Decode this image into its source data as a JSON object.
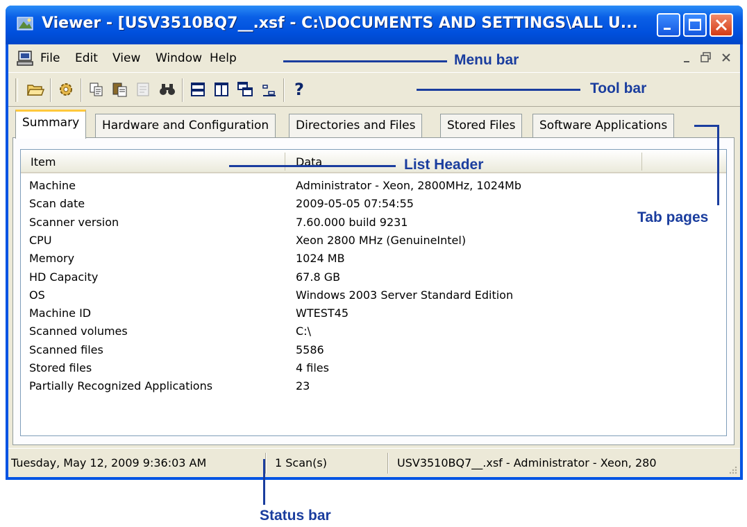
{
  "window": {
    "title": "Viewer - [USV3510BQ7__.xsf - C:\\DOCUMENTS AND SETTINGS\\ALL U...",
    "controls": [
      "minimize-icon",
      "maximize-icon",
      "close-icon"
    ]
  },
  "menu": {
    "items": [
      "File",
      "Edit",
      "View",
      "Window",
      "Help"
    ],
    "mdi_controls": [
      "_",
      "х",
      "×"
    ]
  },
  "toolbar": {
    "icons": [
      "open-icon",
      "settings-icon",
      "copy-icon",
      "paste-icon",
      "properties-icon",
      "find-icon",
      "split-horizontal-icon",
      "split-vertical-icon",
      "cascade-icon",
      "arrange-icon",
      "help-icon"
    ],
    "help_label": "?"
  },
  "tabs": [
    {
      "label": "Summary",
      "active": true
    },
    {
      "label": "Hardware and Configuration",
      "active": false
    },
    {
      "label": "Directories and Files",
      "active": false
    },
    {
      "label": "Stored Files",
      "active": false
    },
    {
      "label": "Software Applications",
      "active": false
    }
  ],
  "list": {
    "headers": [
      "Item",
      "Data"
    ],
    "rows": [
      {
        "item": "Machine",
        "data": "Administrator - Xeon, 2800MHz, 1024Mb"
      },
      {
        "item": "Scan date",
        "data": "2009-05-05 07:54:55"
      },
      {
        "item": "Scanner version",
        "data": "7.60.000 build 9231"
      },
      {
        "item": "CPU",
        "data": "Xeon 2800 MHz (GenuineIntel)"
      },
      {
        "item": "Memory",
        "data": "1024 MB"
      },
      {
        "item": "HD Capacity",
        "data": "67.8 GB"
      },
      {
        "item": "OS",
        "data": "Windows 2003 Server Standard Edition"
      },
      {
        "item": "Machine ID",
        "data": "WTEST45"
      },
      {
        "item": "Scanned volumes",
        "data": "C:\\"
      },
      {
        "item": "Scanned files",
        "data": "5586"
      },
      {
        "item": "Stored files",
        "data": "4 files"
      },
      {
        "item": "Partially Recognized Applications",
        "data": "23"
      }
    ]
  },
  "status": {
    "datetime": "Tuesday, May 12, 2009 9:36:03 AM",
    "scans": "1 Scan(s)",
    "file": "USV3510BQ7__.xsf - Administrator - Xeon, 280"
  },
  "callouts": {
    "menu_bar": "Menu bar",
    "tool_bar": "Tool bar",
    "list_header": "List Header",
    "tab_pages": "Tab pages",
    "status_bar": "Status bar"
  },
  "colors": {
    "titlebar": "#0054e3",
    "callout": "#1a3d9e",
    "active_tab_accent": "#ffc83c",
    "background": "#ece9d8"
  }
}
